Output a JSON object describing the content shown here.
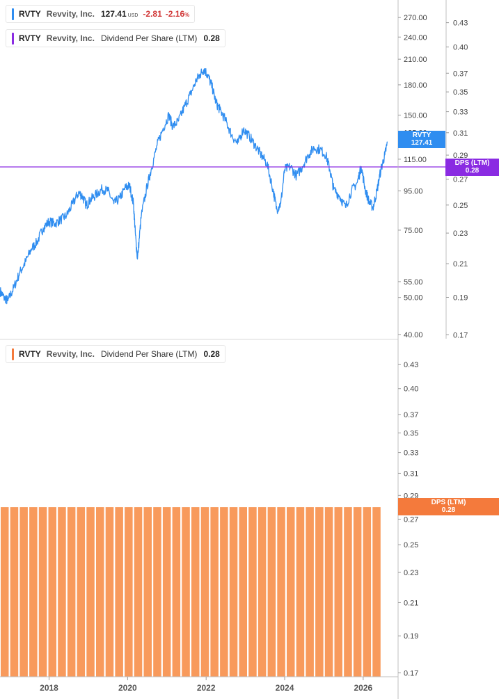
{
  "header": {
    "ticker": "RVTY",
    "company": "Revvity, Inc.",
    "price": "127.41",
    "currency": "USD",
    "change": "-2.81",
    "change_pct": "-2.16",
    "pct_sign": "%",
    "metric": "Dividend Per Share (LTM)",
    "metric_value": "0.28"
  },
  "tags": {
    "price_tag_ticker": "RVTY",
    "price_tag_value": "127.41",
    "dps_tag_label": "DPS (LTM)",
    "dps_tag_value": "0.28"
  },
  "colors": {
    "price_line": "#2f8df0",
    "dps_line_top": "#8a2be2",
    "dps_bars": "#f89a5c",
    "dps_tag_bottom": "#f47a3c",
    "negative": "#d13838"
  },
  "chart_data": [
    {
      "type": "line",
      "name": "price_panel",
      "scale": "log",
      "x_unit": "year",
      "xlim": [
        2016.75,
        2026.8
      ],
      "ylim_left": [
        39,
        300
      ],
      "ylim_right": [
        0.168,
        0.46
      ],
      "right_ticks_outer": [
        "270.00",
        "240.00",
        "210.00",
        "180.00",
        "150.00",
        "135.00",
        "115.00",
        "95.00",
        "75.00",
        "55.00",
        "50.00",
        "40.00"
      ],
      "right_ticks_inner": [
        "0.43",
        "0.40",
        "0.37",
        "0.35",
        "0.33",
        "0.31",
        "0.29",
        "0.27",
        "0.25",
        "0.23",
        "0.21",
        "0.19",
        "0.17"
      ],
      "series": [
        {
          "name": "RVTY",
          "points": [
            [
              2016.75,
              52
            ],
            [
              2016.85,
              50
            ],
            [
              2016.95,
              49
            ],
            [
              2017.1,
              53
            ],
            [
              2017.25,
              58
            ],
            [
              2017.4,
              62
            ],
            [
              2017.55,
              67
            ],
            [
              2017.7,
              70
            ],
            [
              2017.85,
              76
            ],
            [
              2018.0,
              79
            ],
            [
              2018.15,
              78
            ],
            [
              2018.3,
              80
            ],
            [
              2018.45,
              82
            ],
            [
              2018.6,
              88
            ],
            [
              2018.75,
              94
            ],
            [
              2018.85,
              92
            ],
            [
              2018.95,
              87
            ],
            [
              2019.05,
              90
            ],
            [
              2019.2,
              93
            ],
            [
              2019.35,
              96
            ],
            [
              2019.5,
              95
            ],
            [
              2019.65,
              88
            ],
            [
              2019.8,
              91
            ],
            [
              2019.95,
              97
            ],
            [
              2020.05,
              98
            ],
            [
              2020.15,
              88
            ],
            [
              2020.2,
              73
            ],
            [
              2020.25,
              63
            ],
            [
              2020.35,
              82
            ],
            [
              2020.5,
              98
            ],
            [
              2020.6,
              108
            ],
            [
              2020.75,
              125
            ],
            [
              2020.9,
              138
            ],
            [
              2021.05,
              150
            ],
            [
              2021.15,
              140
            ],
            [
              2021.3,
              145
            ],
            [
              2021.45,
              158
            ],
            [
              2021.6,
              170
            ],
            [
              2021.75,
              185
            ],
            [
              2021.85,
              192
            ],
            [
              2021.95,
              198
            ],
            [
              2022.05,
              190
            ],
            [
              2022.15,
              178
            ],
            [
              2022.25,
              162
            ],
            [
              2022.35,
              155
            ],
            [
              2022.5,
              145
            ],
            [
              2022.65,
              133
            ],
            [
              2022.8,
              126
            ],
            [
              2022.95,
              138
            ],
            [
              2023.1,
              132
            ],
            [
              2023.25,
              125
            ],
            [
              2023.4,
              118
            ],
            [
              2023.55,
              112
            ],
            [
              2023.7,
              96
            ],
            [
              2023.8,
              85
            ],
            [
              2023.9,
              88
            ],
            [
              2024.0,
              108
            ],
            [
              2024.15,
              110
            ],
            [
              2024.3,
              104
            ],
            [
              2024.45,
              110
            ],
            [
              2024.6,
              118
            ],
            [
              2024.75,
              123
            ],
            [
              2024.9,
              122
            ],
            [
              2025.05,
              118
            ],
            [
              2025.15,
              108
            ],
            [
              2025.25,
              96
            ],
            [
              2025.4,
              92
            ],
            [
              2025.55,
              86
            ],
            [
              2025.7,
              95
            ],
            [
              2025.85,
              100
            ],
            [
              2025.95,
              110
            ],
            [
              2026.05,
              96
            ],
            [
              2026.15,
              89
            ],
            [
              2026.25,
              86
            ],
            [
              2026.35,
              95
            ],
            [
              2026.45,
              108
            ],
            [
              2026.55,
              118
            ],
            [
              2026.62,
              127.41
            ]
          ]
        },
        {
          "name": "Dividend Per Share (LTM)",
          "axis": "inner",
          "x": [
            2016.75,
            2026.62
          ],
          "y": [
            0.28,
            0.28
          ]
        }
      ]
    },
    {
      "type": "bar",
      "name": "dps_panel",
      "x_unit": "year",
      "xlim": [
        2016.75,
        2026.8
      ],
      "ylim": [
        0.168,
        0.46
      ],
      "right_ticks": [
        "0.43",
        "0.40",
        "0.37",
        "0.35",
        "0.33",
        "0.31",
        "0.29",
        "0.27",
        "0.25",
        "0.23",
        "0.21",
        "0.19",
        "0.17"
      ],
      "x_ticks": [
        "2018",
        "2020",
        "2022",
        "2024",
        "2026"
      ],
      "series": [
        {
          "name": "Dividend Per Share (LTM)",
          "bar_count": 40,
          "values": [
            0.28,
            0.28,
            0.28,
            0.28,
            0.28,
            0.28,
            0.28,
            0.28,
            0.28,
            0.28,
            0.28,
            0.28,
            0.28,
            0.28,
            0.28,
            0.28,
            0.28,
            0.28,
            0.28,
            0.28,
            0.28,
            0.28,
            0.28,
            0.28,
            0.28,
            0.28,
            0.28,
            0.28,
            0.28,
            0.28,
            0.28,
            0.28,
            0.28,
            0.28,
            0.28,
            0.28,
            0.28,
            0.28,
            0.28,
            0.28
          ]
        }
      ]
    }
  ]
}
